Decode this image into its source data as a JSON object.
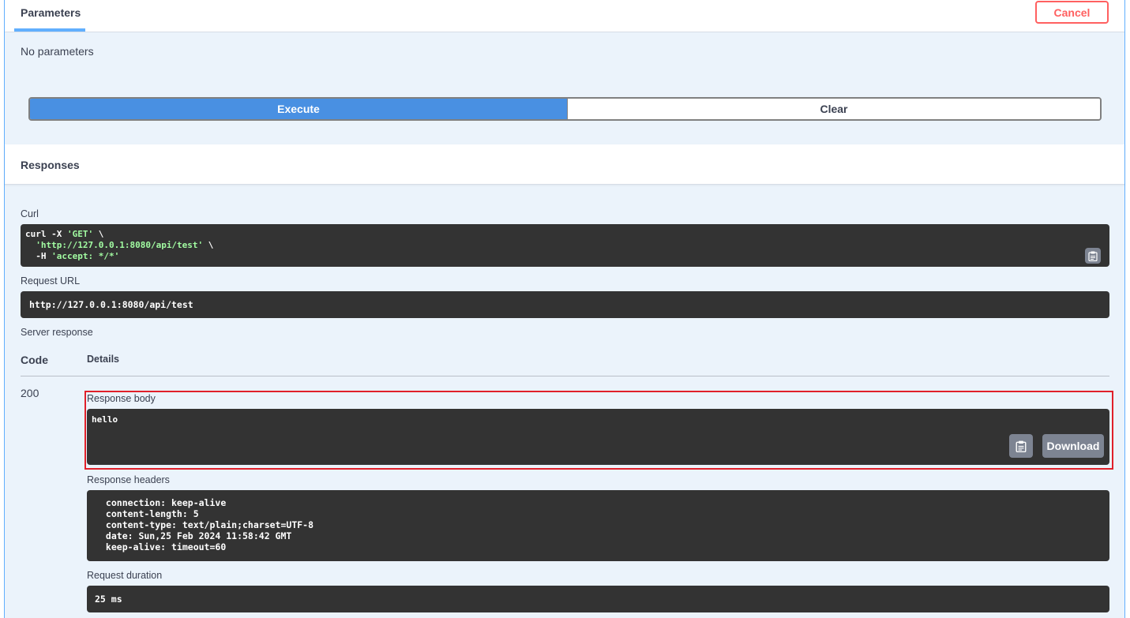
{
  "params": {
    "tab_label": "Parameters",
    "cancel_label": "Cancel",
    "empty_text": "No parameters"
  },
  "actions": {
    "execute_label": "Execute",
    "clear_label": "Clear"
  },
  "responses": {
    "title": "Responses",
    "curl_label": "Curl",
    "curl": {
      "line1_prefix": "curl -X ",
      "line1_method": "'GET'",
      "line1_suffix": " \\",
      "line2_indent": "  ",
      "line2_url": "'http://127.0.0.1:8080/api/test'",
      "line2_suffix": " \\",
      "line3_prefix": "  -H ",
      "line3_header": "'accept: */*'"
    },
    "request_url_label": "Request URL",
    "request_url": "http://127.0.0.1:8080/api/test",
    "server_response_label": "Server response",
    "col_code": "Code",
    "col_details": "Details",
    "status_code": "200",
    "response_body_label": "Response body",
    "response_body": "hello",
    "download_label": "Download",
    "response_headers_label": "Response headers",
    "response_headers": " connection: keep-alive \n content-length: 5 \n content-type: text/plain;charset=UTF-8 \n date: Sun,25 Feb 2024 11:58:42 GMT \n keep-alive: timeout=60 ",
    "request_duration_label": "Request duration",
    "request_duration": "25 ms"
  },
  "icons": {
    "copy": "clipboard-icon"
  },
  "colors": {
    "accent": "#61affe",
    "execute": "#4990e2",
    "cancel": "#ff6060",
    "code_bg": "#333333",
    "highlight": "#e0202a"
  }
}
